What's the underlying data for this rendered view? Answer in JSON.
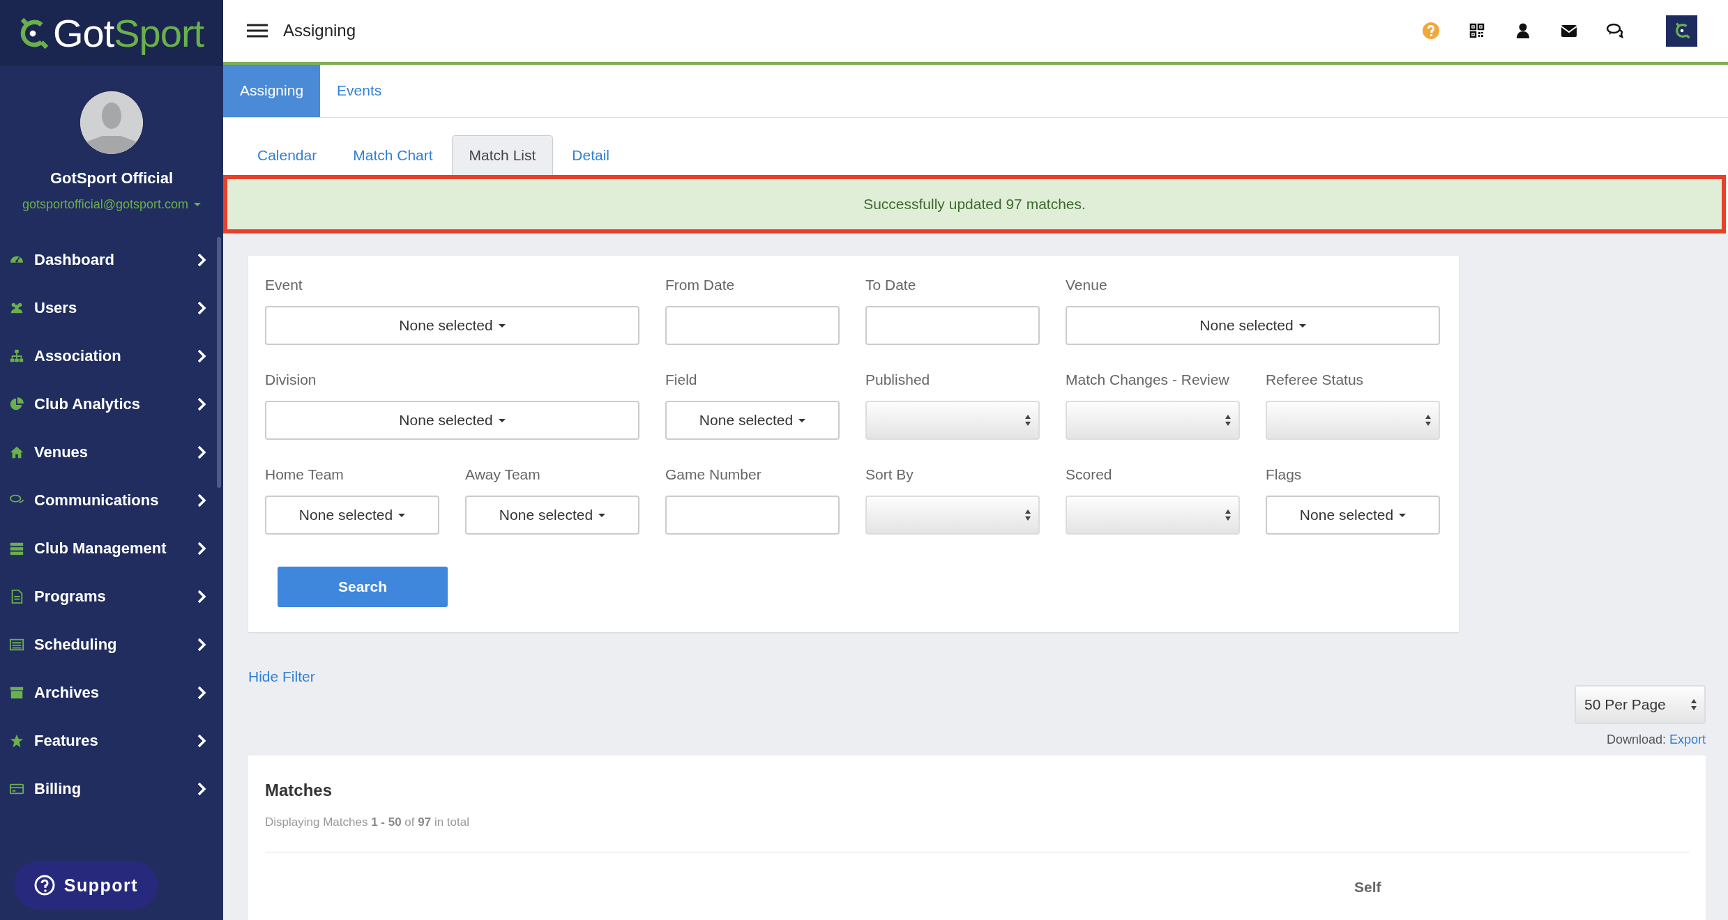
{
  "sidebar": {
    "brand": {
      "part_1": "Got",
      "part_2": "Sport"
    },
    "user": {
      "name": "GotSport Official",
      "email": "gotsportofficial@gotsport.com"
    },
    "items": [
      {
        "label": "Dashboard"
      },
      {
        "label": "Users"
      },
      {
        "label": "Association"
      },
      {
        "label": "Club Analytics"
      },
      {
        "label": "Venues"
      },
      {
        "label": "Communications"
      },
      {
        "label": "Club Management"
      },
      {
        "label": "Programs"
      },
      {
        "label": "Scheduling"
      },
      {
        "label": "Archives"
      },
      {
        "label": "Features"
      },
      {
        "label": "Billing"
      }
    ],
    "support_button": "Support"
  },
  "header": {
    "title": "Assigning"
  },
  "tabs": [
    {
      "label": "Assigning",
      "selected": true
    },
    {
      "label": "Events",
      "selected": false
    }
  ],
  "subtabs": [
    {
      "label": "Calendar",
      "selected": false
    },
    {
      "label": "Match Chart",
      "selected": false
    },
    {
      "label": "Match List",
      "selected": true
    },
    {
      "label": "Detail",
      "selected": false
    }
  ],
  "alert": {
    "message": "Successfully updated 97 matches.",
    "highlighted": true
  },
  "filters": [
    {
      "label": "Event",
      "kind": "wide-multiselect",
      "value": "None selected"
    },
    {
      "label": "From Date",
      "kind": "text"
    },
    {
      "label": "To Date",
      "kind": "text"
    },
    {
      "label": "Venue",
      "kind": "wide-multiselect",
      "value": "None selected"
    },
    {
      "label": "Division",
      "kind": "wide-multiselect",
      "value": "None selected"
    },
    {
      "label": "Field",
      "kind": "multiselect",
      "value": "None selected"
    },
    {
      "label": "Published",
      "kind": "select"
    },
    {
      "label": "Match Changes - Review",
      "kind": "select"
    },
    {
      "label": "Referee Status",
      "kind": "select"
    },
    {
      "label": "Home Team",
      "kind": "multiselect",
      "value": "None selected"
    },
    {
      "label": "Away Team",
      "kind": "multiselect",
      "value": "None selected"
    },
    {
      "label": "Game Number",
      "kind": "text"
    },
    {
      "label": "Sort By",
      "kind": "select"
    },
    {
      "label": "Scored",
      "kind": "select"
    },
    {
      "label": "Flags",
      "kind": "multiselect",
      "value": "None selected"
    }
  ],
  "search_button": "Search",
  "hide_filter_link": "Hide Filter",
  "per_page": "50 Per Page",
  "download": {
    "label": "Download:",
    "link": "Export"
  },
  "matches": {
    "title": "Matches",
    "summary": "Displaying Matches **1 - 50** of **97** in total",
    "column_1": "Self"
  }
}
